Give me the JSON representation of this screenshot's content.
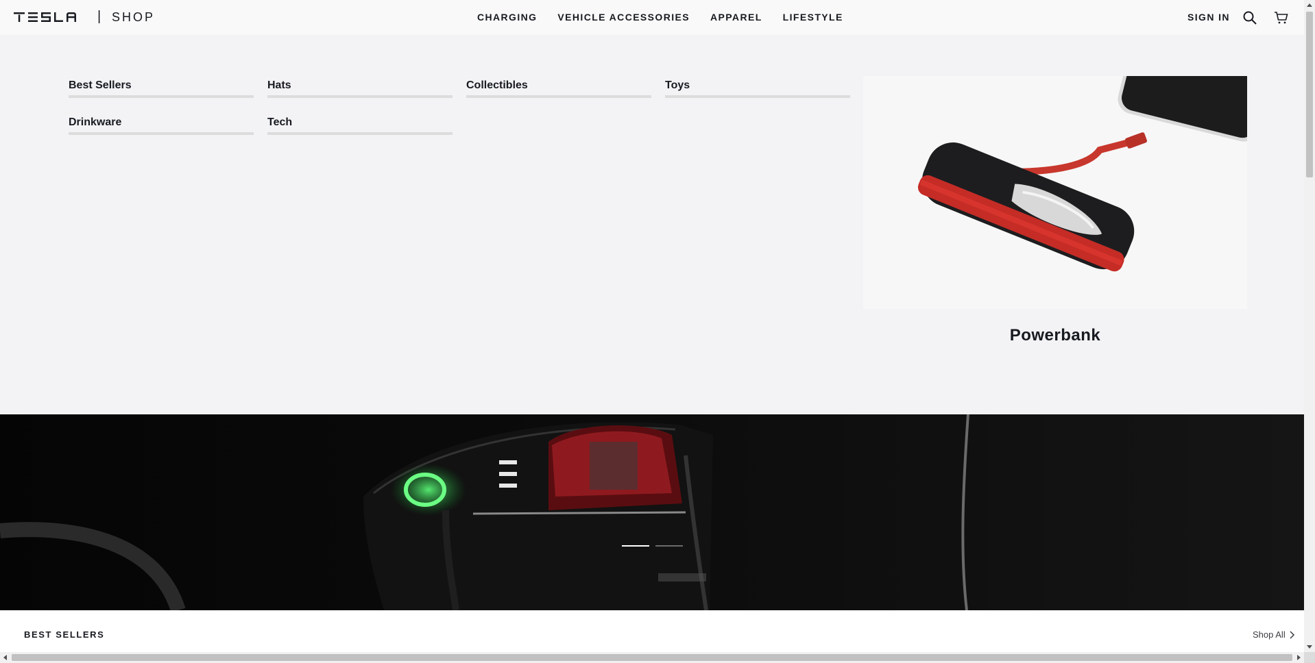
{
  "header": {
    "logo_text": "TESLA",
    "divider": "|",
    "shop_label": "SHOP",
    "nav": [
      {
        "label": "CHARGING"
      },
      {
        "label": "VEHICLE ACCESSORIES"
      },
      {
        "label": "APPAREL"
      },
      {
        "label": "LIFESTYLE"
      }
    ],
    "sign_in": "SIGN IN"
  },
  "menu": {
    "items": [
      {
        "label": "Best Sellers"
      },
      {
        "label": "Hats"
      },
      {
        "label": "Collectibles"
      },
      {
        "label": "Toys"
      },
      {
        "label": "Drinkware"
      },
      {
        "label": "Tech"
      }
    ],
    "promo_title": "Powerbank"
  },
  "hero": {
    "slides_count": 2,
    "active_slide": 1
  },
  "best_sellers": {
    "title": "BEST SELLERS",
    "shop_all": "Shop All"
  },
  "colors": {
    "text": "#171a20",
    "accent_red": "#cc2b2b",
    "charge_green": "#3ddc5c"
  }
}
